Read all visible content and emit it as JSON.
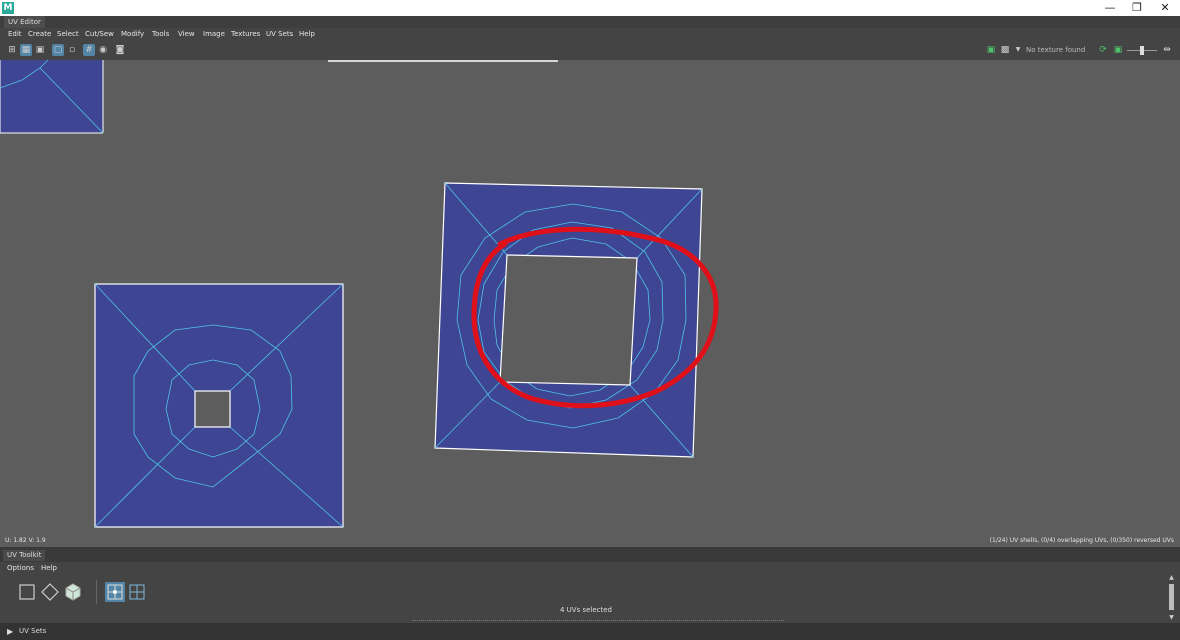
{
  "window": {
    "logo": "M",
    "controls": {
      "minimize": "—",
      "restore": "❐",
      "close": "✕"
    }
  },
  "panel": {
    "title": "UV Editor"
  },
  "menu": [
    "Edit",
    "Create",
    "Select",
    "Cut/Sew",
    "Modify",
    "Tools",
    "View",
    "Image",
    "Textures",
    "UV Sets",
    "Help"
  ],
  "toolbar": {
    "left_icons": [
      "uv-grid-icon",
      "uv-shaded-icon",
      "texture-icon",
      "frame-icon",
      "isolate-icon",
      "grid-toggle-icon",
      "texture-border-icon",
      "snapshot-icon"
    ],
    "texture_status": "No texture found"
  },
  "viewport": {
    "u_v_readout": "U:  1.82 V:  1.9",
    "stats": "(1/24) UV shells, (0/4) overlapping UVs, (0/350) reversed UVs",
    "colors": {
      "background": "#5d5d5d",
      "shell_fill": "#3e4592",
      "edge": "#4fc3e8",
      "border": "#ffffff",
      "selected": "#d81b8c",
      "annotation": "#e0101a"
    }
  },
  "toolkit": {
    "title": "UV Toolkit",
    "menu": [
      "Options",
      "Help"
    ],
    "icons": [
      "box-select-icon",
      "diamond-select-icon",
      "cube-select-icon",
      "uv-select-icon",
      "uv-grid-select-icon"
    ],
    "selection_status": "4 UVs selected"
  },
  "uvsets": {
    "label": "UV Sets"
  }
}
